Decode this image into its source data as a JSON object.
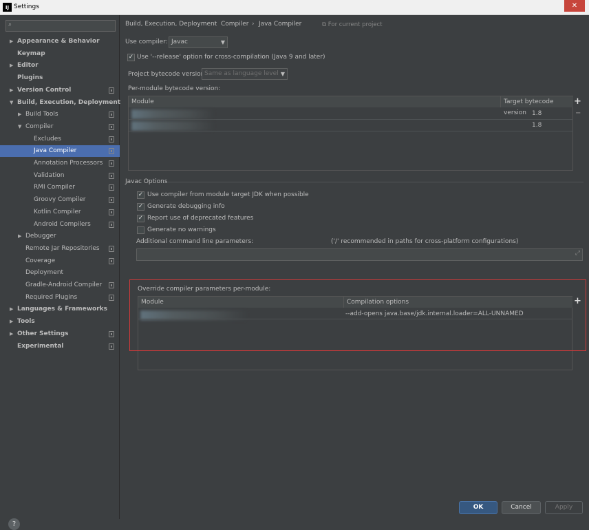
{
  "window": {
    "title": "Settings",
    "app_icon": "IJ",
    "close_glyph": "✕"
  },
  "search": {
    "placeholder": "",
    "icon": "search-icon"
  },
  "sidebar": {
    "items": [
      {
        "label": "Appearance & Behavior",
        "arrow": "▶",
        "bold": true,
        "project_icon": false
      },
      {
        "label": "Keymap",
        "arrow": "",
        "bold": true,
        "project_icon": false
      },
      {
        "label": "Editor",
        "arrow": "▶",
        "bold": true,
        "project_icon": false
      },
      {
        "label": "Plugins",
        "arrow": "",
        "bold": true,
        "project_icon": false
      },
      {
        "label": "Version Control",
        "arrow": "▶",
        "bold": true,
        "project_icon": true
      },
      {
        "label": "Build, Execution, Deployment",
        "arrow": "▼",
        "bold": true,
        "project_icon": false
      },
      {
        "label": "Build Tools",
        "arrow": "▶",
        "bold": false,
        "project_icon": true
      },
      {
        "label": "Compiler",
        "arrow": "▼",
        "bold": false,
        "project_icon": true
      },
      {
        "label": "Excludes",
        "arrow": "",
        "bold": false,
        "project_icon": true
      },
      {
        "label": "Java Compiler",
        "arrow": "",
        "bold": false,
        "project_icon": true,
        "selected": true
      },
      {
        "label": "Annotation Processors",
        "arrow": "",
        "bold": false,
        "project_icon": true
      },
      {
        "label": "Validation",
        "arrow": "",
        "bold": false,
        "project_icon": true
      },
      {
        "label": "RMI Compiler",
        "arrow": "",
        "bold": false,
        "project_icon": true
      },
      {
        "label": "Groovy Compiler",
        "arrow": "",
        "bold": false,
        "project_icon": true
      },
      {
        "label": "Kotlin Compiler",
        "arrow": "",
        "bold": false,
        "project_icon": true
      },
      {
        "label": "Android Compilers",
        "arrow": "",
        "bold": false,
        "project_icon": true
      },
      {
        "label": "Debugger",
        "arrow": "▶",
        "bold": false,
        "project_icon": false
      },
      {
        "label": "Remote Jar Repositories",
        "arrow": "",
        "bold": false,
        "project_icon": true
      },
      {
        "label": "Coverage",
        "arrow": "",
        "bold": false,
        "project_icon": true
      },
      {
        "label": "Deployment",
        "arrow": "",
        "bold": false,
        "project_icon": false
      },
      {
        "label": "Gradle-Android Compiler",
        "arrow": "",
        "bold": false,
        "project_icon": true
      },
      {
        "label": "Required Plugins",
        "arrow": "",
        "bold": false,
        "project_icon": true
      },
      {
        "label": "Languages & Frameworks",
        "arrow": "▶",
        "bold": true,
        "project_icon": false
      },
      {
        "label": "Tools",
        "arrow": "▶",
        "bold": true,
        "project_icon": false
      },
      {
        "label": "Other Settings",
        "arrow": "▶",
        "bold": true,
        "project_icon": true
      },
      {
        "label": "Experimental",
        "arrow": "",
        "bold": true,
        "project_icon": true
      }
    ]
  },
  "breadcrumb": {
    "part1": "Build, Execution, Deployment",
    "part2": "Compiler",
    "part3": "Java Compiler",
    "sep": "›",
    "scope": "For current project"
  },
  "compiler": {
    "use_compiler_label": "Use compiler:",
    "use_compiler_value": "Javac",
    "release_option_label": "Use '--release' option for cross-compilation (Java 9 and later)",
    "release_option_checked": true,
    "bytecode_label": "Project bytecode version:",
    "bytecode_value": "Same as language level",
    "per_module_label": "Per-module bytecode version:",
    "per_module_table": {
      "columns": [
        "Module",
        "Target bytecode version"
      ],
      "rows": [
        {
          "module": "",
          "version": "1.8"
        },
        {
          "module": "",
          "version": "1.8"
        }
      ]
    }
  },
  "javac": {
    "section_title": "Javac Options",
    "options": [
      {
        "label": "Use compiler from module target JDK when possible",
        "checked": true
      },
      {
        "label": "Generate debugging info",
        "checked": true
      },
      {
        "label": "Report use of deprecated features",
        "checked": true
      },
      {
        "label": "Generate no warnings",
        "checked": false
      }
    ],
    "additional_params_label": "Additional command line parameters:",
    "additional_params_hint": "('/' recommended in paths for cross-platform configurations)",
    "additional_params_value": ""
  },
  "override": {
    "label": "Override compiler parameters per-module:",
    "columns": [
      "Module",
      "Compilation options"
    ],
    "rows": [
      {
        "module": "",
        "options": "--add-opens java.base/jdk.internal.loader=ALL-UNNAMED"
      }
    ]
  },
  "footer": {
    "help": "?",
    "ok": "OK",
    "cancel": "Cancel",
    "apply": "Apply"
  },
  "colors": {
    "accent": "#4b6eaf",
    "ok_button": "#365880",
    "highlight_outline": "#d33a3a"
  }
}
